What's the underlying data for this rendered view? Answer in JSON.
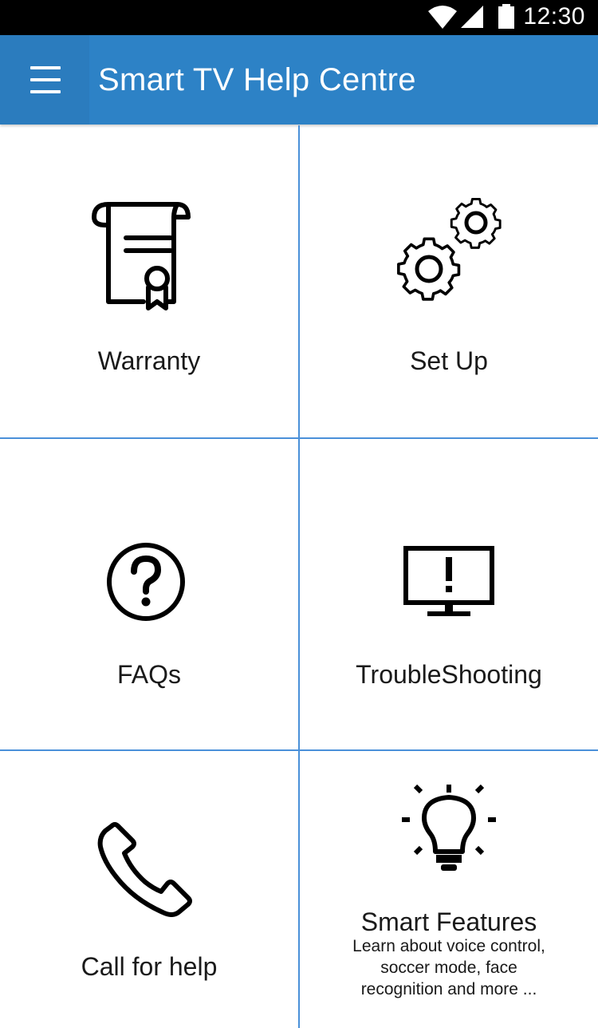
{
  "status_bar": {
    "time": "12:30",
    "icons": [
      "wifi-icon",
      "signal-icon",
      "battery-icon"
    ]
  },
  "app_bar": {
    "menu_icon": "menu-icon",
    "title": "Smart TV Help Centre",
    "color": "#2d82c6"
  },
  "tiles": [
    {
      "label": "Warranty",
      "icon": "certificate-icon"
    },
    {
      "label": "Set Up",
      "icon": "gears-icon"
    },
    {
      "label": "FAQs",
      "icon": "question-icon"
    },
    {
      "label": "TroubleShooting",
      "icon": "monitor-alert-icon"
    },
    {
      "label": "Call for help",
      "icon": "phone-icon"
    },
    {
      "label": "Smart Features",
      "icon": "lightbulb-icon",
      "description_lines": [
        "Learn about voice control,",
        "soccer mode, face",
        "recognition and more ..."
      ]
    }
  ],
  "colors": {
    "divider": "#4a90d9",
    "status_bar": "#000000"
  }
}
